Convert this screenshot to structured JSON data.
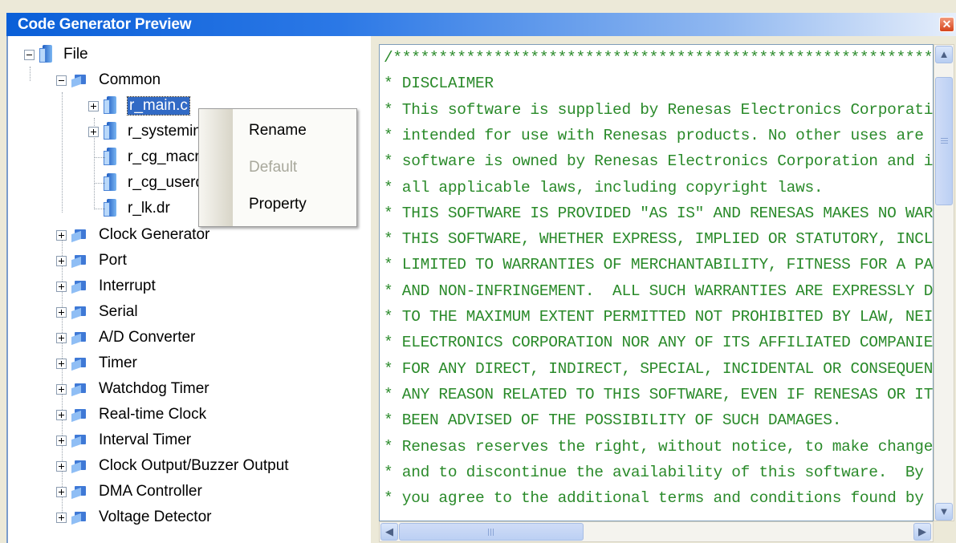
{
  "window": {
    "title": "Code Generator Preview",
    "close_glyph": "✕",
    "accent_color": "#0a5fd8"
  },
  "tree": {
    "root": {
      "label": "File",
      "icon": "file-stack-icon"
    },
    "common": {
      "label": "Common",
      "icon": "folder-icon",
      "files": [
        {
          "label": "r_main.c",
          "selected": true,
          "expandable": true
        },
        {
          "label": "r_systeminit.c",
          "expandable": true
        },
        {
          "label": "r_cg_macrodriver.h",
          "expandable": false
        },
        {
          "label": "r_cg_userdefine.h",
          "expandable": false
        },
        {
          "label": "r_lk.dr",
          "expandable": false
        }
      ]
    },
    "folders": [
      "Clock Generator",
      "Port",
      "Interrupt",
      "Serial",
      "A/D Converter",
      "Timer",
      "Watchdog Timer",
      "Real-time Clock",
      "Interval Timer",
      "Clock Output/Buzzer Output",
      "DMA Controller",
      "Voltage Detector"
    ]
  },
  "context_menu": {
    "items": [
      {
        "label": "Rename",
        "enabled": true
      },
      {
        "label": "Default",
        "enabled": false
      },
      {
        "label": "Property",
        "enabled": true
      }
    ]
  },
  "code": {
    "text_color": "#2a8a2a",
    "lines": [
      "/***************************************************************",
      "* DISCLAIMER",
      "* This software is supplied by Renesas Electronics Corporation",
      "* intended for use with Renesas products. No other uses are au",
      "* software is owned by Renesas Electronics Corporation and is p",
      "* all applicable laws, including copyright laws.",
      "* THIS SOFTWARE IS PROVIDED \"AS IS\" AND RENESAS MAKES NO WARRAN",
      "* THIS SOFTWARE, WHETHER EXPRESS, IMPLIED OR STATUTORY, INCLUDI",
      "* LIMITED TO WARRANTIES OF MERCHANTABILITY, FITNESS FOR A PARTI",
      "* AND NON-INFRINGEMENT.  ALL SUCH WARRANTIES ARE EXPRESSLY DISC",
      "* TO THE MAXIMUM EXTENT PERMITTED NOT PROHIBITED BY LAW, NEITHE",
      "* ELECTRONICS CORPORATION NOR ANY OF ITS AFFILIATED COMPANIES S",
      "* FOR ANY DIRECT, INDIRECT, SPECIAL, INCIDENTAL OR CONSEQUENTIA",
      "* ANY REASON RELATED TO THIS SOFTWARE, EVEN IF RENESAS OR ITS A",
      "* BEEN ADVISED OF THE POSSIBILITY OF SUCH DAMAGES.",
      "* Renesas reserves the right, without notice, to make changes",
      "* and to discontinue the availability of this software.  By us",
      "* you agree to the additional terms and conditions found by ac"
    ]
  },
  "scrollbars": {
    "up_glyph": "▲",
    "down_glyph": "▼",
    "left_glyph": "◀",
    "right_glyph": "▶"
  }
}
